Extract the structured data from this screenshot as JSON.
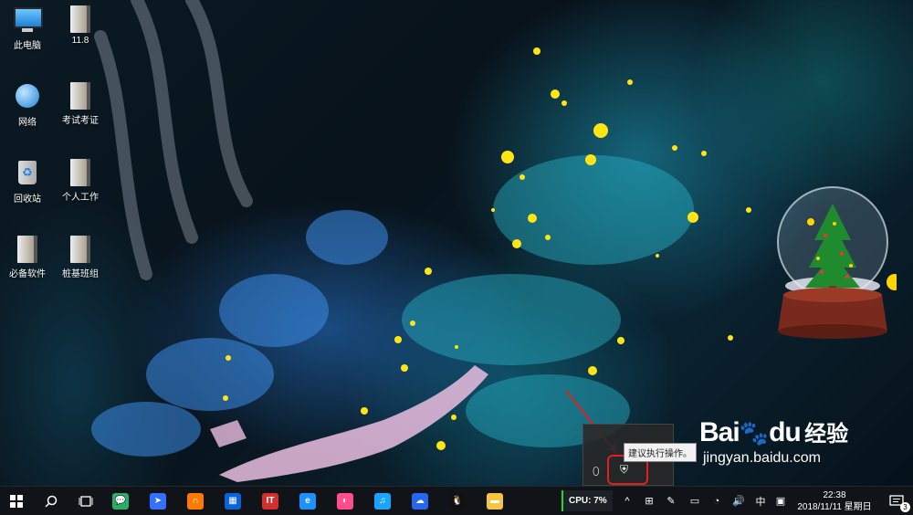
{
  "desktop_icons": [
    {
      "name": "this-pc",
      "label": "此电脑",
      "type": "monitor"
    },
    {
      "name": "network",
      "label": "网络",
      "type": "globe"
    },
    {
      "name": "recycle-bin",
      "label": "回收站",
      "type": "bin"
    },
    {
      "name": "essential-software",
      "label": "必备软件",
      "type": "folder"
    },
    {
      "name": "folder-11-8",
      "label": "11.8",
      "type": "folder"
    },
    {
      "name": "exam-pass",
      "label": "考试考证",
      "type": "folder"
    },
    {
      "name": "personal-work",
      "label": "个人工作",
      "type": "folder"
    },
    {
      "name": "zhuangji-class",
      "label": "桩基班组",
      "type": "folder"
    }
  ],
  "tray_popup": {
    "tooltip": "建议执行操作。",
    "icons": [
      "windows-defender-icon",
      "security-shield-icon"
    ]
  },
  "watermark": {
    "brand_bai": "Bai",
    "brand_du": "du",
    "brand_cn": "经验",
    "url": "jingyan.baidu.com"
  },
  "taskbar": {
    "start_icon": "windows-logo-icon",
    "search_icon": "search-icon",
    "task_view_icon": "task-view-icon",
    "pinned_apps": [
      {
        "name": "wechat-icon",
        "glyph": "💬",
        "color": "#2aae67"
      },
      {
        "name": "feishu-icon",
        "glyph": "➤",
        "color": "#3370ff"
      },
      {
        "name": "uc-browser-icon",
        "glyph": "∩",
        "color": "#ff7a00"
      },
      {
        "name": "outlook-calendar-icon",
        "glyph": "▦",
        "color": "#0a64d8"
      },
      {
        "name": "it-home-icon",
        "glyph": "IT",
        "color": "#d32f2f"
      },
      {
        "name": "ie-browser-icon",
        "glyph": "e",
        "color": "#1e90ff"
      },
      {
        "name": "360-browser-icon",
        "glyph": "◐",
        "color": "#ff4d8d"
      },
      {
        "name": "qq-mail-icon",
        "glyph": "♫",
        "color": "#1aa3ff"
      },
      {
        "name": "baidu-netdisk-icon",
        "glyph": "☁",
        "color": "#2468f2"
      },
      {
        "name": "qq-icon",
        "glyph": "🐧",
        "color": "#111111"
      },
      {
        "name": "file-explorer-icon",
        "glyph": "▬",
        "color": "#f5c542"
      }
    ],
    "cpu_label": "CPU: 7%",
    "tray_icons": [
      {
        "name": "show-hidden-icons-icon",
        "glyph": "^"
      },
      {
        "name": "grid-tray-icon",
        "glyph": "⊞"
      },
      {
        "name": "pen-tray-icon",
        "glyph": "✎"
      },
      {
        "name": "battery-icon",
        "glyph": "▭"
      },
      {
        "name": "wifi-icon",
        "glyph": "◔"
      },
      {
        "name": "volume-icon",
        "glyph": "🔊"
      },
      {
        "name": "ime-chinese-icon",
        "glyph": "中"
      },
      {
        "name": "ime-mode-icon",
        "glyph": "▣"
      }
    ],
    "time": "22:38",
    "date": "2018/11/11 星期日",
    "notification_count": "3"
  }
}
